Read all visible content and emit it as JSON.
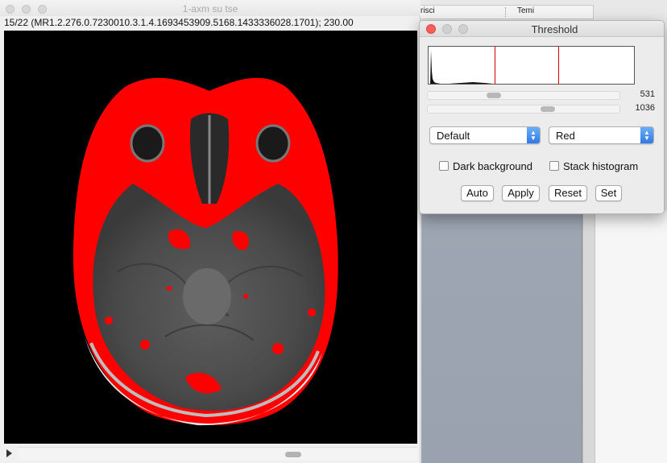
{
  "background_app": {
    "menu_item_1": "risci",
    "menu_item_2": "Temi"
  },
  "image_window": {
    "title": "1-axm su tse",
    "info_line": "15/22 (MR1.2.276.0.7230010.3.1.4.1693453909.5168.1433336028.1701); 230.00"
  },
  "threshold_dialog": {
    "title": "Threshold",
    "min_value": "531",
    "max_value": "1036",
    "method": "Default",
    "display_mode": "Red",
    "dark_background_label": "Dark background",
    "dark_background_checked": false,
    "stack_histogram_label": "Stack histogram",
    "stack_histogram_checked": false,
    "buttons": {
      "auto": "Auto",
      "apply": "Apply",
      "reset": "Reset",
      "set": "Set"
    },
    "colors": {
      "threshold_overlay": "#ff0000",
      "selection_box": "#d20000",
      "close_button": "#fc5b57"
    }
  }
}
